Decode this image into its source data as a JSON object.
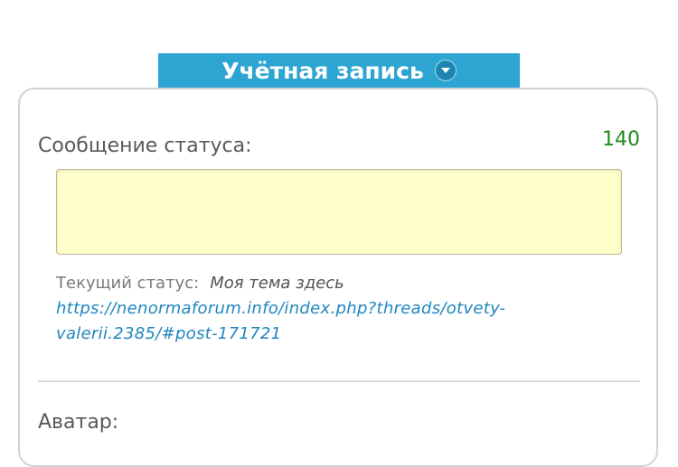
{
  "header": {
    "tab_label": "Учётная запись"
  },
  "status": {
    "label": "Сообщение статуса:",
    "remaining": "140",
    "input_value": "",
    "current_label": "Текущий статус:",
    "current_value": "Моя тема здесь",
    "link_line1": "https://nenormaforum.info/index.php?threads/otvety-",
    "link_line2": "valerii.2385/#post-171721"
  },
  "avatar": {
    "label": "Аватар:"
  },
  "colors": {
    "tab_bg": "#2da5d2",
    "input_bg": "#ffffc9",
    "counter": "#1f8a1f",
    "link": "#1f86bf"
  }
}
